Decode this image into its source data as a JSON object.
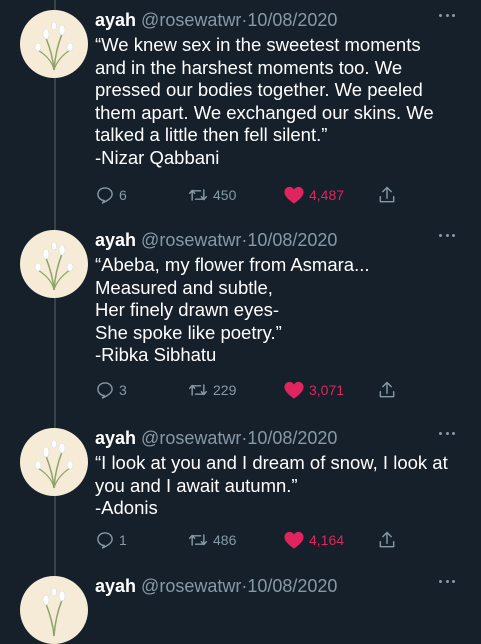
{
  "tweets": [
    {
      "name": "ayah",
      "handle": "@rosewatwr",
      "separator": "·",
      "date": "10/08/2020",
      "lines": [
        "“We knew sex in the sweetest moments",
        "and in the harshest moments too. We",
        "pressed our bodies together. We peeled",
        "them apart. We exchanged our skins. We",
        "talked a little then fell silent.”",
        "-Nizar Qabbani"
      ],
      "replies": "6",
      "retweets": "450",
      "likes": "4,487"
    },
    {
      "name": "ayah",
      "handle": "@rosewatwr",
      "separator": "·",
      "date": "10/08/2020",
      "lines": [
        "“Abeba, my flower from Asmara...",
        "Measured and subtle,",
        "Her finely drawn eyes-",
        "She spoke like poetry.”",
        "-Ribka Sibhatu"
      ],
      "replies": "3",
      "retweets": "229",
      "likes": "3,071"
    },
    {
      "name": "ayah",
      "handle": "@rosewatwr",
      "separator": "·",
      "date": "10/08/2020",
      "lines": [
        "“I look at you and I dream of snow, I look at",
        "you and I await autumn.”",
        "-Adonis"
      ],
      "replies": "1",
      "retweets": "486",
      "likes": "4,164"
    },
    {
      "name": "ayah",
      "handle": "@rosewatwr",
      "separator": "·",
      "date": "10/08/2020",
      "lines": [],
      "replies": "",
      "retweets": "",
      "likes": ""
    }
  ],
  "icons": {
    "reply": "reply-icon",
    "retweet": "retweet-icon",
    "like": "heart-icon",
    "share": "share-icon",
    "more": "more-icon",
    "avatar": "flower-avatar"
  },
  "colors": {
    "background": "#15202b",
    "text": "#ffffff",
    "muted": "#8899a6",
    "like": "#e0245e",
    "avatar_bg": "#f6ebd6"
  }
}
